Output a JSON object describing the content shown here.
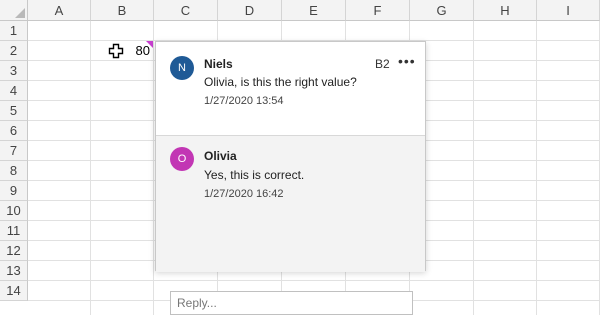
{
  "columns": [
    "A",
    "B",
    "C",
    "D",
    "E",
    "F",
    "G",
    "H",
    "I"
  ],
  "rows": [
    "1",
    "2",
    "3",
    "4",
    "5",
    "6",
    "7",
    "8",
    "9",
    "10",
    "11",
    "12",
    "13",
    "14"
  ],
  "cell_b2_value": "80",
  "comment_marker_color": "#c83fd0",
  "comment": {
    "cell_ref": "B2",
    "more_label": "•••",
    "thread": [
      {
        "initial": "N",
        "author": "Niels",
        "text": "Olivia, is this the right value?",
        "time": "1/27/2020 13:54",
        "avatar_color": "#1f5a96"
      },
      {
        "initial": "O",
        "author": "Olivia",
        "text": "Yes, this is correct.",
        "time": "1/27/2020 16:42",
        "avatar_color": "#c236b4"
      }
    ],
    "reply_placeholder": "Reply..."
  }
}
